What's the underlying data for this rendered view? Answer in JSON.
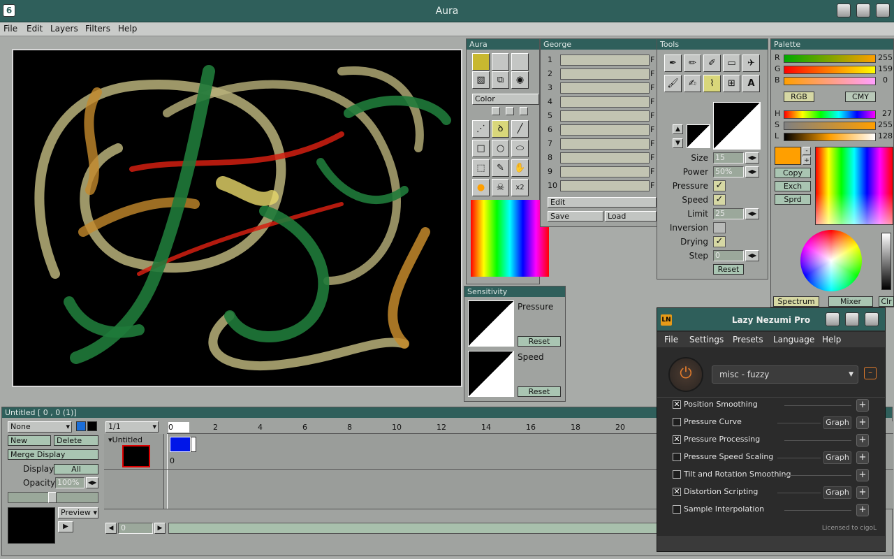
{
  "app": {
    "title": "Aura"
  },
  "menu": [
    "File",
    "Edit",
    "Layers",
    "Filters",
    "Help"
  ],
  "aura_panel": {
    "title": "Aura",
    "color_label": "Color"
  },
  "george_panel": {
    "title": "George",
    "rows": [
      "1",
      "2",
      "3",
      "4",
      "5",
      "6",
      "7",
      "8",
      "9",
      "10"
    ],
    "f_label": "F",
    "edit": "Edit",
    "save": "Save",
    "load": "Load"
  },
  "tools_panel": {
    "title": "Tools",
    "size_label": "Size",
    "size_value": "15",
    "power_label": "Power",
    "power_value": "50%",
    "pressure_label": "Pressure",
    "speed_label": "Speed",
    "limit_label": "Limit",
    "limit_value": "25",
    "inversion_label": "Inversion",
    "drying_label": "Drying",
    "step_label": "Step",
    "step_value": "0",
    "reset": "Reset"
  },
  "sensitivity_panel": {
    "title": "Sensitivity",
    "pressure": "Pressure",
    "speed": "Speed",
    "reset": "Reset"
  },
  "palette_panel": {
    "title": "Palette",
    "r": "R",
    "g": "G",
    "b": "B",
    "r_val": "255",
    "g_val": "159",
    "b_val": "0",
    "rgb": "RGB",
    "cmy": "CMY",
    "h": "H",
    "s": "S",
    "l": "L",
    "h_val": "27",
    "s_val": "255",
    "l_val": "128",
    "copy": "Copy",
    "exch": "Exch",
    "sprd": "Sprd",
    "minus": "-",
    "plus": "+",
    "spectrum": "Spectrum",
    "mixer": "Mixer",
    "clr": "Clr",
    "current_color": "#ff9f00"
  },
  "timeline": {
    "title": "Untitled [ 0 , 0  (1)]",
    "none": "None",
    "frame_sel": "1/1",
    "new": "New",
    "delete": "Delete",
    "merge": "Merge Display",
    "display_label": "Display",
    "display_value": "All",
    "opacity_label": "Opacity",
    "opacity_value": "100%",
    "preview": "Preview",
    "layer_name": "Untitled",
    "ticks": [
      "0",
      "2",
      "4",
      "6",
      "8",
      "10",
      "12",
      "14",
      "16",
      "18",
      "20"
    ],
    "frame0": "0",
    "frame_field": "0"
  },
  "lazy_nezumi": {
    "title": "Lazy Nezumi Pro",
    "logo": "LN",
    "menu": [
      "File",
      "Settings",
      "Presets",
      "Language",
      "Help"
    ],
    "preset": "misc - fuzzy",
    "minus": "–",
    "plus": "+",
    "graph": "Graph",
    "options": [
      {
        "label": "Position Smoothing",
        "checked": true,
        "graph": false
      },
      {
        "label": "Pressure Curve",
        "checked": false,
        "graph": true
      },
      {
        "label": "Pressure Processing",
        "checked": true,
        "graph": false
      },
      {
        "label": "Pressure Speed Scaling",
        "checked": false,
        "graph": true
      },
      {
        "label": "Tilt and Rotation Smoothing",
        "checked": false,
        "graph": false
      },
      {
        "label": "Distortion Scripting",
        "checked": true,
        "graph": true
      },
      {
        "label": "Sample Interpolation",
        "checked": false,
        "graph": false
      }
    ],
    "licensed": "Licensed to cigoL"
  },
  "colors": {
    "accent": "#2f5f5b",
    "canvas": "#000000"
  }
}
